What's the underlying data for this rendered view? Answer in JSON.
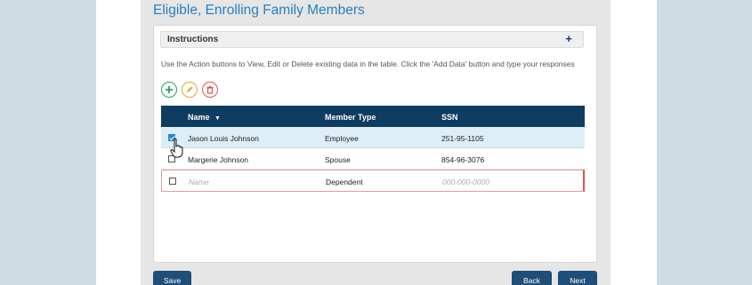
{
  "page": {
    "title": "Eligible, Enrolling Family Members"
  },
  "instructions": {
    "label": "Instructions",
    "expand_symbol": "+",
    "text": "Use the Action buttons to View, Edit or Delete existing data in the table. Click the 'Add Data' button and type your responses"
  },
  "actions": [
    {
      "name": "add",
      "icon": "plus-icon",
      "color": "#2e9c6a"
    },
    {
      "name": "edit",
      "icon": "pencil-icon",
      "color": "#e8a426"
    },
    {
      "name": "delete",
      "icon": "trash-icon",
      "color": "#d9534f"
    }
  ],
  "table": {
    "columns": [
      "Name",
      "Member Type",
      "SSN"
    ],
    "sort_indicator": "▼",
    "rows": [
      {
        "name": "Jason Louis Johnson",
        "type": "Employee",
        "ssn": "251-95-1105",
        "checked": true
      },
      {
        "name": "Margerie Johnson",
        "type": "Spouse",
        "ssn": "854-96-3076",
        "checked": false
      }
    ],
    "new_row": {
      "name_placeholder": "Name",
      "type": "Dependent",
      "ssn_placeholder": "000-000-0000"
    }
  },
  "footer": {
    "save_label": "Save",
    "back_label": "Back",
    "next_label": "Next"
  },
  "colors": {
    "header_bg": "#0f3c61",
    "title": "#2a7fbf",
    "button_bg": "#1f4e79",
    "selected_row": "#ddeef7"
  }
}
